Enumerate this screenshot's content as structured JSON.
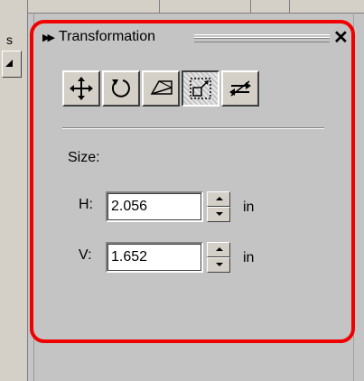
{
  "left_pane": {
    "fragment_text": "s"
  },
  "docker": {
    "title": "Transformation",
    "collapse_icon": "double-chevron-right-icon",
    "close_glyph": "✕",
    "tools": [
      {
        "icon": "move-icon",
        "active": false
      },
      {
        "icon": "rotate-icon",
        "active": false
      },
      {
        "icon": "scale-mirror-icon",
        "active": false
      },
      {
        "icon": "size-icon",
        "active": true
      },
      {
        "icon": "skew-icon",
        "active": false
      }
    ],
    "size_label": "Size:",
    "h_label": "H:",
    "h_value": "2.056",
    "v_label": "V:",
    "v_value": "1.652",
    "unit": "in"
  },
  "colors": {
    "highlight_border": "#f00000",
    "panel_bg": "#c4c4c4"
  }
}
